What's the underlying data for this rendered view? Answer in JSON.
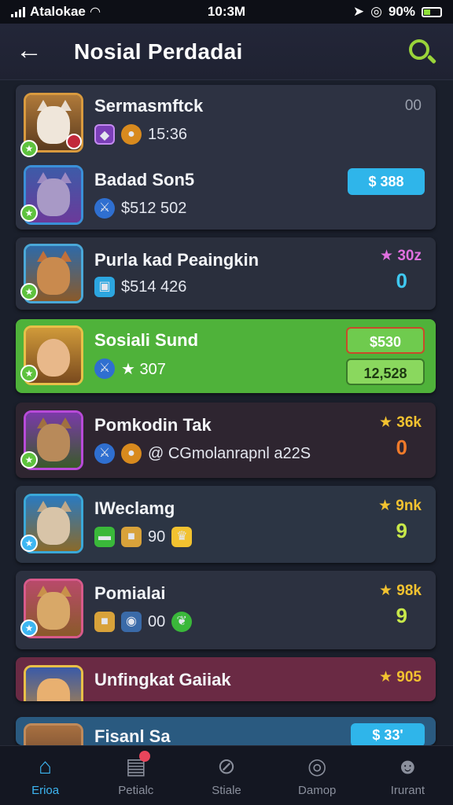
{
  "status": {
    "carrier": "Atalokae",
    "time": "10:3M",
    "battery": "90%"
  },
  "header": {
    "title": "Nosial Perdadai"
  },
  "items": [
    {
      "name": "Sermasmftck",
      "sub_text": "15:36",
      "right_top": "00",
      "right_pill": ""
    },
    {
      "name": "Badad Son5",
      "sub_text": "$512 502",
      "right_top": "",
      "right_pill": "$ 388"
    },
    {
      "name": "Purla kad Peaingkin",
      "sub_text": "$514 426",
      "right_top": "★ 30z",
      "right_big": "0"
    },
    {
      "name": "Sosiali Sund",
      "sub_text": "★ 307",
      "right_pill": "$530",
      "right_pill2": "12,528"
    },
    {
      "name": "Pomkodin Tak",
      "sub_text": "@ CGmolanrapnl a22S",
      "right_top": "★ 36k",
      "right_big": "0"
    },
    {
      "name": "IWeclamg",
      "sub_text": "90",
      "right_top": "★ 9nk",
      "right_big": "9"
    },
    {
      "name": "Pomialai",
      "sub_text": "00",
      "right_top": "★ 98k",
      "right_big": "9"
    },
    {
      "name": "Unfingkat Gaiiak",
      "sub_text": "",
      "right_top": "★ 905",
      "right_big": ""
    },
    {
      "name": "Fisanl Sa",
      "sub_text": "",
      "right_pill": "$ 33'"
    }
  ],
  "nav": [
    {
      "label": "Erioa",
      "icon": "home-icon"
    },
    {
      "label": "Petialc",
      "icon": "clipboard-icon"
    },
    {
      "label": "Stiale",
      "icon": "block-icon"
    },
    {
      "label": "Damop",
      "icon": "search-icon"
    },
    {
      "label": "Irurant",
      "icon": "profile-icon"
    }
  ],
  "colors": {
    "accent_green": "#4fb23a",
    "accent_blue": "#3db6f2",
    "star_gold": "#f2c230"
  }
}
